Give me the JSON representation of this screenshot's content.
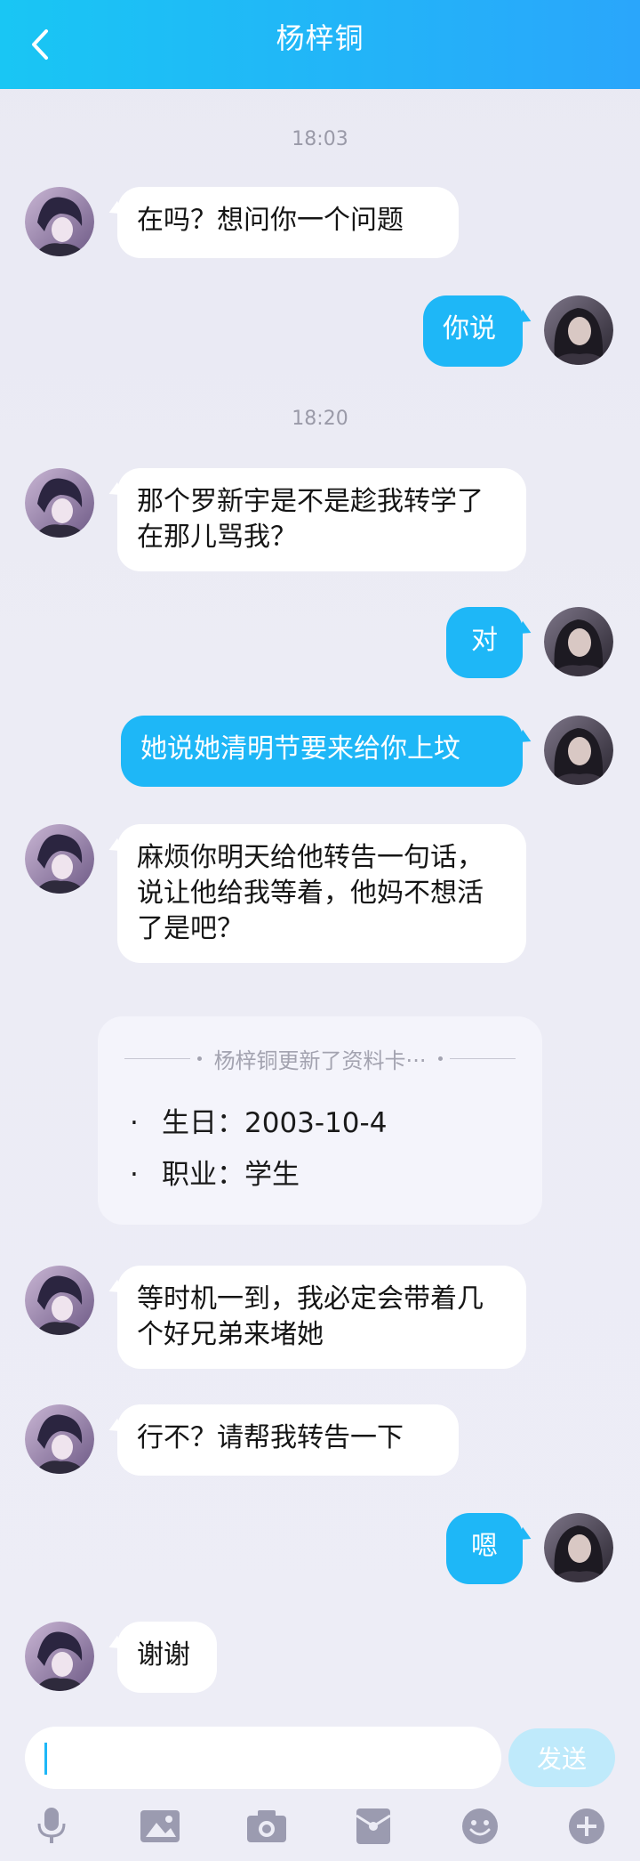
{
  "header": {
    "title": "杨梓铜"
  },
  "timestamps": [
    "18:03",
    "18:20"
  ],
  "messages": [
    {
      "side": "in",
      "text": "在吗？想问你一个问题"
    },
    {
      "side": "out",
      "text": "你说"
    },
    {
      "side": "in",
      "text": "那个罗新宇是不是趁我转学了在那儿骂我？"
    },
    {
      "side": "out",
      "text": "对"
    },
    {
      "side": "out",
      "text": "她说她清明节要来给你上坟"
    },
    {
      "side": "in",
      "text": "麻烦你明天给他转告一句话，说让他给我等着，他妈不想活了是吧？"
    },
    {
      "side": "in",
      "text": "等时机一到，我必定会带着几个好兄弟来堵她"
    },
    {
      "side": "in",
      "text": "行不？请帮我转告一下"
    },
    {
      "side": "out",
      "text": "嗯"
    },
    {
      "side": "in",
      "text": "谢谢"
    }
  ],
  "profile_card": {
    "title": "杨梓铜更新了资料卡···",
    "rows": [
      {
        "bullet": "·",
        "label": "生日：",
        "value": "2003-10-4"
      },
      {
        "bullet": "·",
        "label": "职业：",
        "value": "学生"
      }
    ]
  },
  "input": {
    "value": "",
    "send_label": "发送"
  },
  "toolbar": {
    "icons": [
      "microphone-icon",
      "image-icon",
      "camera-icon",
      "red-packet-icon",
      "emoji-icon",
      "plus-icon"
    ]
  },
  "colors": {
    "header_gradient_start": "#19c6f4",
    "header_gradient_end": "#2aa6fb",
    "outgoing_bubble": "#1eb7f7",
    "incoming_bubble": "#ffffff",
    "send_button": "#bfeafb",
    "background": "#ebebf4"
  }
}
